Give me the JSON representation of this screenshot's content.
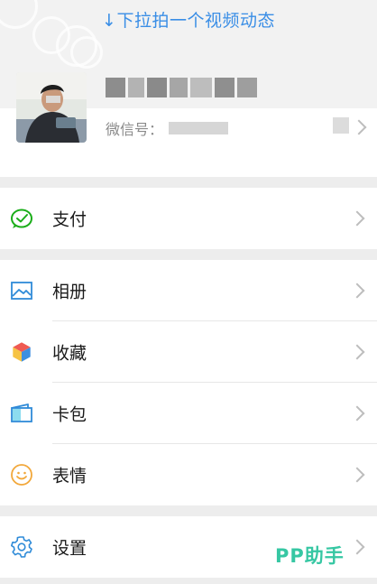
{
  "header": {
    "pulldown_text": "↓下拉拍一个视频动态"
  },
  "profile": {
    "wechat_id_label": "微信号："
  },
  "menu": {
    "pay": "支付",
    "album": "相册",
    "favorites": "收藏",
    "cards": "卡包",
    "stickers": "表情",
    "settings": "设置"
  },
  "watermark": "PP助手",
  "colors": {
    "accent_blue": "#3a8ee6",
    "pay_green": "#1aad19",
    "sticker_orange": "#f2a83b",
    "watermark_teal": "#36c7a3"
  }
}
